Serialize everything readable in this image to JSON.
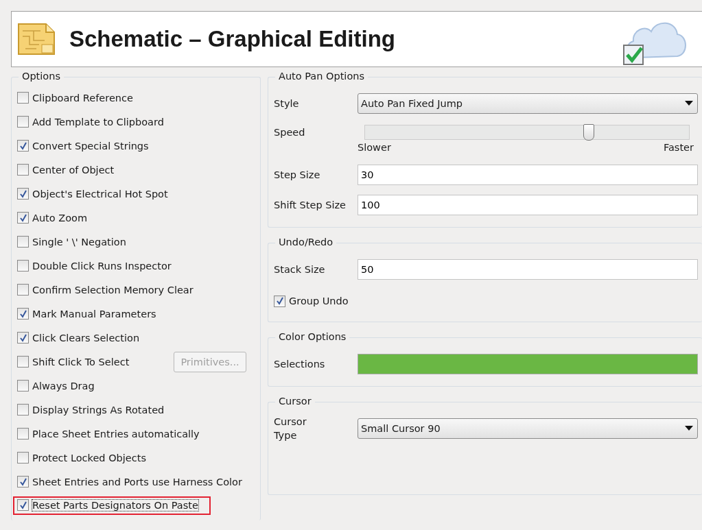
{
  "header": {
    "title": "Schematic – Graphical Editing"
  },
  "options": {
    "title": "Options",
    "items": [
      {
        "label": "Clipboard Reference",
        "checked": false
      },
      {
        "label": "Add Template to Clipboard",
        "checked": false
      },
      {
        "label": "Convert Special Strings",
        "checked": true
      },
      {
        "label": "Center of Object",
        "checked": false
      },
      {
        "label": "Object's Electrical Hot Spot",
        "checked": true
      },
      {
        "label": "Auto Zoom",
        "checked": true
      },
      {
        "label": "Single ' \\' Negation",
        "checked": false
      },
      {
        "label": "Double Click Runs Inspector",
        "checked": false
      },
      {
        "label": "Confirm Selection Memory Clear",
        "checked": false
      },
      {
        "label": "Mark Manual Parameters",
        "checked": true
      },
      {
        "label": "Click Clears Selection",
        "checked": true
      },
      {
        "label": "Shift Click To Select",
        "checked": false,
        "button": {
          "label": "Primitives...",
          "disabled": true
        }
      },
      {
        "label": "Always Drag",
        "checked": false
      },
      {
        "label": "Display Strings As Rotated",
        "checked": false
      },
      {
        "label": "Place Sheet Entries automatically",
        "checked": false
      },
      {
        "label": "Protect Locked Objects",
        "checked": false
      },
      {
        "label": "Sheet Entries and Ports use Harness Color",
        "checked": true
      },
      {
        "label": "Reset Parts Designators On Paste",
        "checked": true,
        "highlighted": true
      }
    ]
  },
  "auto_pan": {
    "title": "Auto Pan Options",
    "style_label": "Style",
    "style_value": "Auto Pan Fixed Jump",
    "speed_label": "Speed",
    "speed": {
      "level": 0.69
    },
    "slower": "Slower",
    "faster": "Faster",
    "step_label": "Step Size",
    "step_value": "30",
    "shift_label": "Shift Step Size",
    "shift_value": "100"
  },
  "undo_redo": {
    "title": "Undo/Redo",
    "stack_label": "Stack Size",
    "stack_value": "50",
    "group_undo": {
      "label": "Group Undo",
      "checked": true
    }
  },
  "color_options": {
    "title": "Color Options",
    "selections_label": "Selections",
    "selections": {
      "color": "#6ab744"
    }
  },
  "cursor": {
    "title": "Cursor",
    "type_label": "Cursor Type",
    "type_value": "Small Cursor 90"
  }
}
